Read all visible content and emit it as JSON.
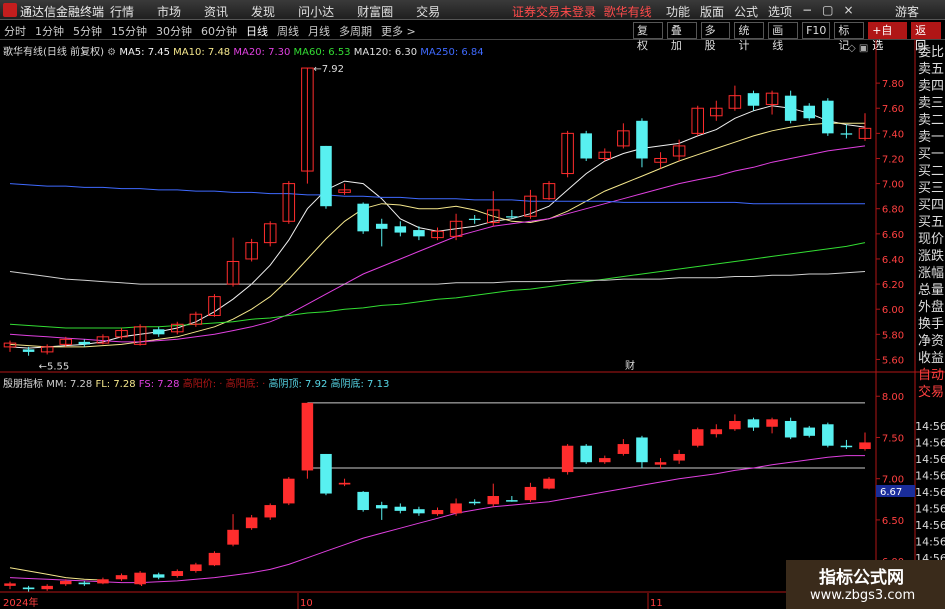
{
  "topbar": {
    "app_name": "通达信金融终端",
    "menu": [
      "行情",
      "市场",
      "资讯",
      "发现",
      "问小达",
      "财富圈",
      "交易"
    ],
    "notice": "证券交易未登录",
    "stock_name": "歌华有线",
    "right_menu": [
      "功能",
      "版面",
      "公式",
      "选项",
      "−",
      "▢",
      "×"
    ],
    "guest": "游客"
  },
  "periodbar": {
    "periods": [
      "分时",
      "1分钟",
      "5分钟",
      "15分钟",
      "30分钟",
      "60分钟",
      "日线",
      "周线",
      "月线",
      "多周期",
      "更多 >"
    ],
    "active_period": "日线",
    "tools": [
      "复权",
      "叠加",
      "多股",
      "统计",
      "画线",
      "F10",
      "标记",
      "+自选",
      "返回"
    ]
  },
  "main_legend": {
    "title": "歌华有线(日线 前复权)",
    "ma": [
      {
        "label": "MA5: 7.45",
        "color": "#f0f0f0"
      },
      {
        "label": "MA10: 7.48",
        "color": "#f5e78c"
      },
      {
        "label": "MA20: 7.30",
        "color": "#e040e0"
      },
      {
        "label": "MA60: 6.53",
        "color": "#33dd33"
      },
      {
        "label": "MA120: 6.30",
        "color": "#e0e0e0"
      },
      {
        "label": "MA250: 6.84",
        "color": "#3f6aff"
      }
    ]
  },
  "sub_legend": {
    "title": "殷朋指标",
    "items": [
      {
        "label": "MM: 7.28",
        "color": "#cccccc"
      },
      {
        "label": "FL: 7.28",
        "color": "#f5e78c"
      },
      {
        "label": "FS: 7.28",
        "color": "#e040e0"
      },
      {
        "label": "高阳价: ·",
        "color": "#b01616"
      },
      {
        "label": "高阳底: ·",
        "color": "#b01616"
      },
      {
        "label": "高阴顶: 7.92",
        "color": "#58d8e8"
      },
      {
        "label": "高阴底: 7.13",
        "color": "#58d8e8"
      }
    ]
  },
  "annotations": {
    "high": "7.92",
    "low": "5.55",
    "cai": "财",
    "date_2024": "2024年",
    "date_10": "10",
    "date_11": "11"
  },
  "current_price_tag": "6.67",
  "side_panel": [
    "委比",
    "卖五",
    "卖四",
    "卖三",
    "卖二",
    "卖一",
    "买一",
    "买二",
    "买三",
    "买四",
    "买五",
    "现价",
    "涨跌",
    "涨幅",
    "总量",
    "外盘",
    "换手",
    "净资",
    "收益",
    "自动",
    "交易"
  ],
  "side_times": [
    "14:56",
    "14:56",
    "14:56",
    "14:56",
    "14:56",
    "14:56",
    "14:56",
    "14:56",
    "14:56",
    "14:56"
  ],
  "watermark": {
    "line1": "指标公式网",
    "line2": "www.zbgs3.com"
  },
  "chart_data": [
    {
      "type": "candlestick",
      "title": "歌华有线(日线 前复权)",
      "y_ticks": [
        7.8,
        7.6,
        7.4,
        7.2,
        7.0,
        6.8,
        6.6,
        6.4,
        6.2,
        6.0,
        5.8,
        5.6
      ],
      "ylim": [
        5.5,
        8.0
      ],
      "candles": [
        [
          5.7,
          5.73,
          5.66,
          5.75
        ],
        [
          5.68,
          5.66,
          5.63,
          5.7
        ],
        [
          5.66,
          5.7,
          5.64,
          5.72
        ],
        [
          5.72,
          5.76,
          5.7,
          5.78
        ],
        [
          5.74,
          5.72,
          5.7,
          5.76
        ],
        [
          5.73,
          5.78,
          5.72,
          5.8
        ],
        [
          5.78,
          5.83,
          5.76,
          5.85
        ],
        [
          5.72,
          5.86,
          5.71,
          5.88
        ],
        [
          5.84,
          5.8,
          5.78,
          5.86
        ],
        [
          5.82,
          5.88,
          5.8,
          5.9
        ],
        [
          5.88,
          5.96,
          5.86,
          5.98
        ],
        [
          5.95,
          6.1,
          5.94,
          6.12
        ],
        [
          6.2,
          6.38,
          6.18,
          6.57
        ],
        [
          6.4,
          6.53,
          6.38,
          6.56
        ],
        [
          6.53,
          6.68,
          6.5,
          6.7
        ],
        [
          6.7,
          7.0,
          6.68,
          7.02
        ],
        [
          7.1,
          7.92,
          7.0,
          7.92
        ],
        [
          7.3,
          6.82,
          6.8,
          7.3
        ],
        [
          6.93,
          6.95,
          6.91,
          7.0
        ],
        [
          6.84,
          6.62,
          6.6,
          6.85
        ],
        [
          6.68,
          6.64,
          6.5,
          6.72
        ],
        [
          6.66,
          6.61,
          6.58,
          6.7
        ],
        [
          6.63,
          6.58,
          6.55,
          6.66
        ],
        [
          6.57,
          6.62,
          6.55,
          6.65
        ],
        [
          6.58,
          6.7,
          6.55,
          6.76
        ],
        [
          6.72,
          6.71,
          6.68,
          6.75
        ],
        [
          6.69,
          6.79,
          6.66,
          6.94
        ],
        [
          6.74,
          6.73,
          6.72,
          6.79
        ],
        [
          6.74,
          6.9,
          6.72,
          6.95
        ],
        [
          6.88,
          7.0,
          6.87,
          7.02
        ],
        [
          7.08,
          7.4,
          7.05,
          7.42
        ],
        [
          7.4,
          7.2,
          7.18,
          7.42
        ],
        [
          7.2,
          7.25,
          7.18,
          7.28
        ],
        [
          7.3,
          7.42,
          7.28,
          7.48
        ],
        [
          7.5,
          7.2,
          7.13,
          7.52
        ],
        [
          7.17,
          7.2,
          7.12,
          7.25
        ],
        [
          7.22,
          7.3,
          7.18,
          7.35
        ],
        [
          7.4,
          7.6,
          7.38,
          7.62
        ],
        [
          7.54,
          7.6,
          7.5,
          7.66
        ],
        [
          7.6,
          7.7,
          7.58,
          7.78
        ],
        [
          7.72,
          7.62,
          7.58,
          7.74
        ],
        [
          7.63,
          7.72,
          7.55,
          7.74
        ],
        [
          7.7,
          7.5,
          7.48,
          7.74
        ],
        [
          7.62,
          7.52,
          7.5,
          7.64
        ],
        [
          7.66,
          7.4,
          7.38,
          7.68
        ],
        [
          7.4,
          7.39,
          7.36,
          7.47
        ],
        [
          7.36,
          7.44,
          7.34,
          7.56
        ]
      ],
      "ma_lines": [
        {
          "name": "MA5",
          "color": "#f0f0f0",
          "values": [
            5.7,
            5.69,
            5.7,
            5.71,
            5.72,
            5.74,
            5.78,
            5.8,
            5.82,
            5.85,
            5.9,
            5.98,
            6.08,
            6.2,
            6.35,
            6.55,
            6.8,
            6.95,
            7.02,
            7.0,
            6.88,
            6.72,
            6.65,
            6.62,
            6.64,
            6.66,
            6.7,
            6.72,
            6.76,
            6.82,
            6.95,
            7.08,
            7.18,
            7.24,
            7.28,
            7.3,
            7.32,
            7.38,
            7.43,
            7.52,
            7.58,
            7.62,
            7.6,
            7.56,
            7.5,
            7.47,
            7.45
          ]
        },
        {
          "name": "MA10",
          "color": "#f5e78c",
          "values": [
            5.72,
            5.71,
            5.7,
            5.7,
            5.7,
            5.71,
            5.72,
            5.74,
            5.76,
            5.78,
            5.82,
            5.86,
            5.92,
            6.0,
            6.1,
            6.24,
            6.4,
            6.56,
            6.7,
            6.8,
            6.84,
            6.83,
            6.8,
            6.8,
            6.82,
            6.79,
            6.74,
            6.7,
            6.69,
            6.72,
            6.78,
            6.86,
            6.94,
            7.0,
            7.06,
            7.12,
            7.18,
            7.23,
            7.28,
            7.33,
            7.38,
            7.42,
            7.45,
            7.47,
            7.48,
            7.48,
            7.48
          ]
        },
        {
          "name": "MA20",
          "color": "#e040e0",
          "values": [
            5.8,
            5.79,
            5.78,
            5.77,
            5.76,
            5.75,
            5.74,
            5.74,
            5.75,
            5.76,
            5.78,
            5.8,
            5.83,
            5.86,
            5.9,
            5.96,
            6.04,
            6.12,
            6.2,
            6.28,
            6.34,
            6.4,
            6.46,
            6.52,
            6.58,
            6.62,
            6.66,
            6.68,
            6.7,
            6.72,
            6.76,
            6.8,
            6.84,
            6.88,
            6.92,
            6.96,
            7.0,
            7.03,
            7.06,
            7.1,
            7.13,
            7.17,
            7.2,
            7.23,
            7.26,
            7.28,
            7.3
          ]
        },
        {
          "name": "MA60",
          "color": "#33dd33",
          "values": [
            5.88,
            5.87,
            5.86,
            5.85,
            5.85,
            5.85,
            5.85,
            5.86,
            5.86,
            5.87,
            5.88,
            5.89,
            5.9,
            5.92,
            5.93,
            5.95,
            5.97,
            5.98,
            6.0,
            6.01,
            6.03,
            6.04,
            6.06,
            6.08,
            6.09,
            6.11,
            6.13,
            6.15,
            6.16,
            6.18,
            6.2,
            6.22,
            6.24,
            6.26,
            6.28,
            6.3,
            6.32,
            6.34,
            6.36,
            6.38,
            6.4,
            6.42,
            6.44,
            6.46,
            6.48,
            6.5,
            6.53
          ]
        },
        {
          "name": "MA120",
          "color": "#d0d0d0",
          "values": [
            6.3,
            6.28,
            6.26,
            6.24,
            6.23,
            6.22,
            6.21,
            6.2,
            6.2,
            6.2,
            6.2,
            6.2,
            6.2,
            6.2,
            6.2,
            6.2,
            6.2,
            6.2,
            6.2,
            6.2,
            6.2,
            6.2,
            6.2,
            6.2,
            6.21,
            6.21,
            6.21,
            6.22,
            6.22,
            6.22,
            6.23,
            6.23,
            6.23,
            6.24,
            6.24,
            6.24,
            6.25,
            6.25,
            6.25,
            6.26,
            6.26,
            6.27,
            6.27,
            6.28,
            6.28,
            6.29,
            6.3
          ]
        },
        {
          "name": "MA250",
          "color": "#3f6aff",
          "values": [
            7.0,
            6.99,
            6.98,
            6.98,
            6.97,
            6.97,
            6.96,
            6.96,
            6.95,
            6.95,
            6.94,
            6.94,
            6.93,
            6.93,
            6.92,
            6.92,
            6.91,
            6.91,
            6.9,
            6.9,
            6.89,
            6.89,
            6.88,
            6.88,
            6.88,
            6.87,
            6.87,
            6.87,
            6.86,
            6.86,
            6.86,
            6.86,
            6.86,
            6.85,
            6.85,
            6.85,
            6.85,
            6.85,
            6.85,
            6.85,
            6.84,
            6.84,
            6.84,
            6.84,
            6.84,
            6.84,
            6.84
          ]
        }
      ]
    },
    {
      "type": "indicator",
      "title": "殷朋指标",
      "y_ticks": [
        8.0,
        7.5,
        7.0,
        6.5,
        6.0
      ],
      "ylim": [
        5.65,
        8.1
      ],
      "levels": [
        7.92,
        7.13
      ],
      "fs_values": [
        5.8,
        5.79,
        5.78,
        5.77,
        5.76,
        5.75,
        5.74,
        5.74,
        5.75,
        5.76,
        5.78,
        5.8,
        5.83,
        5.86,
        5.9,
        5.96,
        6.04,
        6.12,
        6.2,
        6.28,
        6.34,
        6.4,
        6.46,
        6.52,
        6.58,
        6.62,
        6.66,
        6.68,
        6.7,
        6.72,
        6.76,
        6.8,
        6.84,
        6.88,
        6.92,
        6.96,
        7.0,
        7.03,
        7.06,
        7.1,
        7.13,
        7.17,
        7.2,
        7.23,
        7.26,
        7.28,
        7.28
      ],
      "mm_values": [
        5.92,
        5.88,
        5.84,
        5.8,
        5.78,
        5.77
      ]
    }
  ]
}
